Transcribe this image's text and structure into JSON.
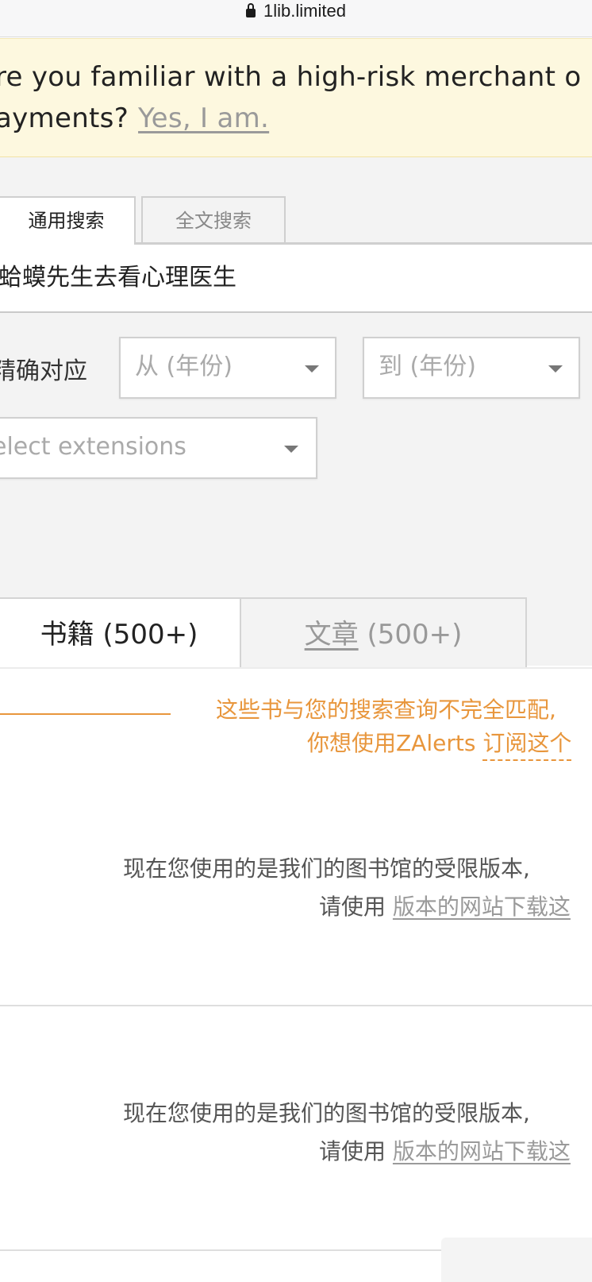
{
  "browser": {
    "url": "1lib.limited",
    "lock_icon": "lock-icon"
  },
  "banner": {
    "line1": "re you familiar with a high-risk merchant o",
    "line2": "ayments?",
    "link": "Yes, I am."
  },
  "search": {
    "tabs": [
      {
        "label": "通用搜索",
        "active": true
      },
      {
        "label": "全文搜索",
        "active": false
      }
    ],
    "query": "蛤蟆先生去看心理医生",
    "exact_label": "精确对应",
    "year_from_placeholder": "从 (年份)",
    "year_to_placeholder": "到 (年份)",
    "extensions_placeholder": "elect extensions"
  },
  "results": {
    "tabs": [
      {
        "label": "书籍",
        "count": "(500+)",
        "active": true
      },
      {
        "label": "文章",
        "count": "(500+)",
        "active": false
      }
    ],
    "notice_line1": "这些书与您的搜索查询不完全匹配,",
    "notice_line2_text": "你想使用ZAlerts",
    "notice_line2_link": "订阅这个",
    "restricted_blocks": [
      {
        "line1": "现在您使用的是我们的图书馆的受限版本,",
        "line2_text": "请使用",
        "line2_link": "版本的网站下载这"
      },
      {
        "line1": "现在您使用的是我们的图书馆的受限版本,",
        "line2_text": "请使用",
        "line2_link": "版本的网站下载这"
      }
    ]
  },
  "colors": {
    "banner_bg": "#fdf8df",
    "accent_orange": "#e8963c",
    "search_bg": "#f3f3f3"
  }
}
